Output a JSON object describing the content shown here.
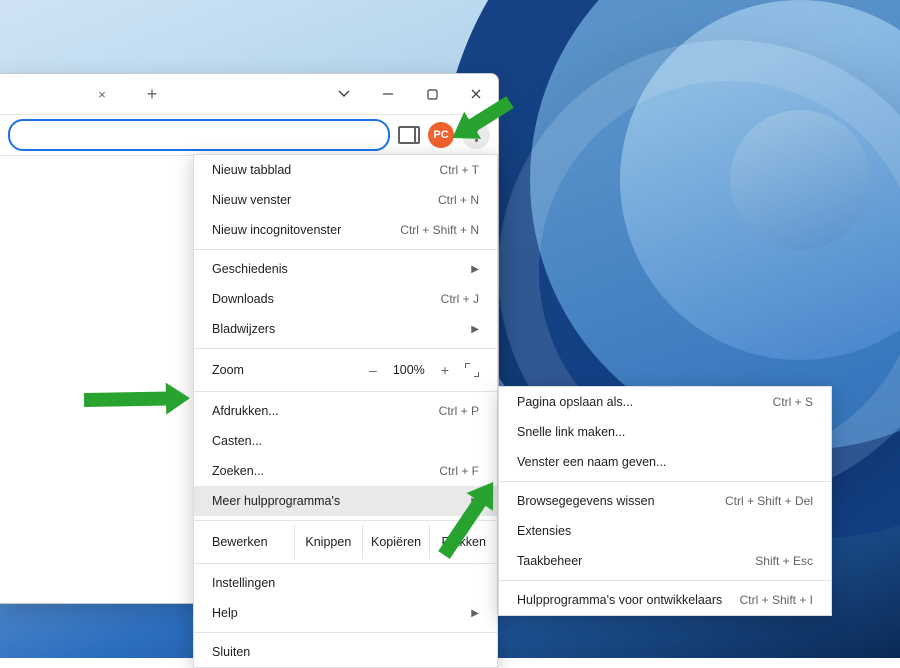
{
  "titlebar": {
    "close_tab": "×",
    "new_tab": "+"
  },
  "toolbar": {
    "avatar": "PC"
  },
  "menu": {
    "new_tab": {
      "label": "Nieuw tabblad",
      "shortcut": "Ctrl + T"
    },
    "new_window": {
      "label": "Nieuw venster",
      "shortcut": "Ctrl + N"
    },
    "new_incognito": {
      "label": "Nieuw incognitovenster",
      "shortcut": "Ctrl + Shift + N"
    },
    "history": {
      "label": "Geschiedenis"
    },
    "downloads": {
      "label": "Downloads",
      "shortcut": "Ctrl + J"
    },
    "bookmarks": {
      "label": "Bladwijzers"
    },
    "zoom": {
      "label": "Zoom",
      "minus": "–",
      "value": "100%",
      "plus": "+"
    },
    "print": {
      "label": "Afdrukken...",
      "shortcut": "Ctrl + P"
    },
    "cast": {
      "label": "Casten..."
    },
    "find": {
      "label": "Zoeken...",
      "shortcut": "Ctrl + F"
    },
    "more_tools": {
      "label": "Meer hulpprogramma's"
    },
    "edit": {
      "label": "Bewerken",
      "cut": "Knippen",
      "copy": "Kopiëren",
      "paste": "Plakken"
    },
    "settings": {
      "label": "Instellingen"
    },
    "help": {
      "label": "Help"
    },
    "exit": {
      "label": "Sluiten"
    }
  },
  "submenu": {
    "save_as": {
      "label": "Pagina opslaan als...",
      "shortcut": "Ctrl + S"
    },
    "create_link": {
      "label": "Snelle link maken..."
    },
    "name_window": {
      "label": "Venster een naam geven..."
    },
    "clear_data": {
      "label": "Browsegegevens wissen",
      "shortcut": "Ctrl + Shift + Del"
    },
    "extensions": {
      "label": "Extensies"
    },
    "task_manager": {
      "label": "Taakbeheer",
      "shortcut": "Shift + Esc"
    },
    "dev_tools": {
      "label": "Hulpprogramma's voor ontwikkelaars",
      "shortcut": "Ctrl + Shift + I"
    }
  }
}
